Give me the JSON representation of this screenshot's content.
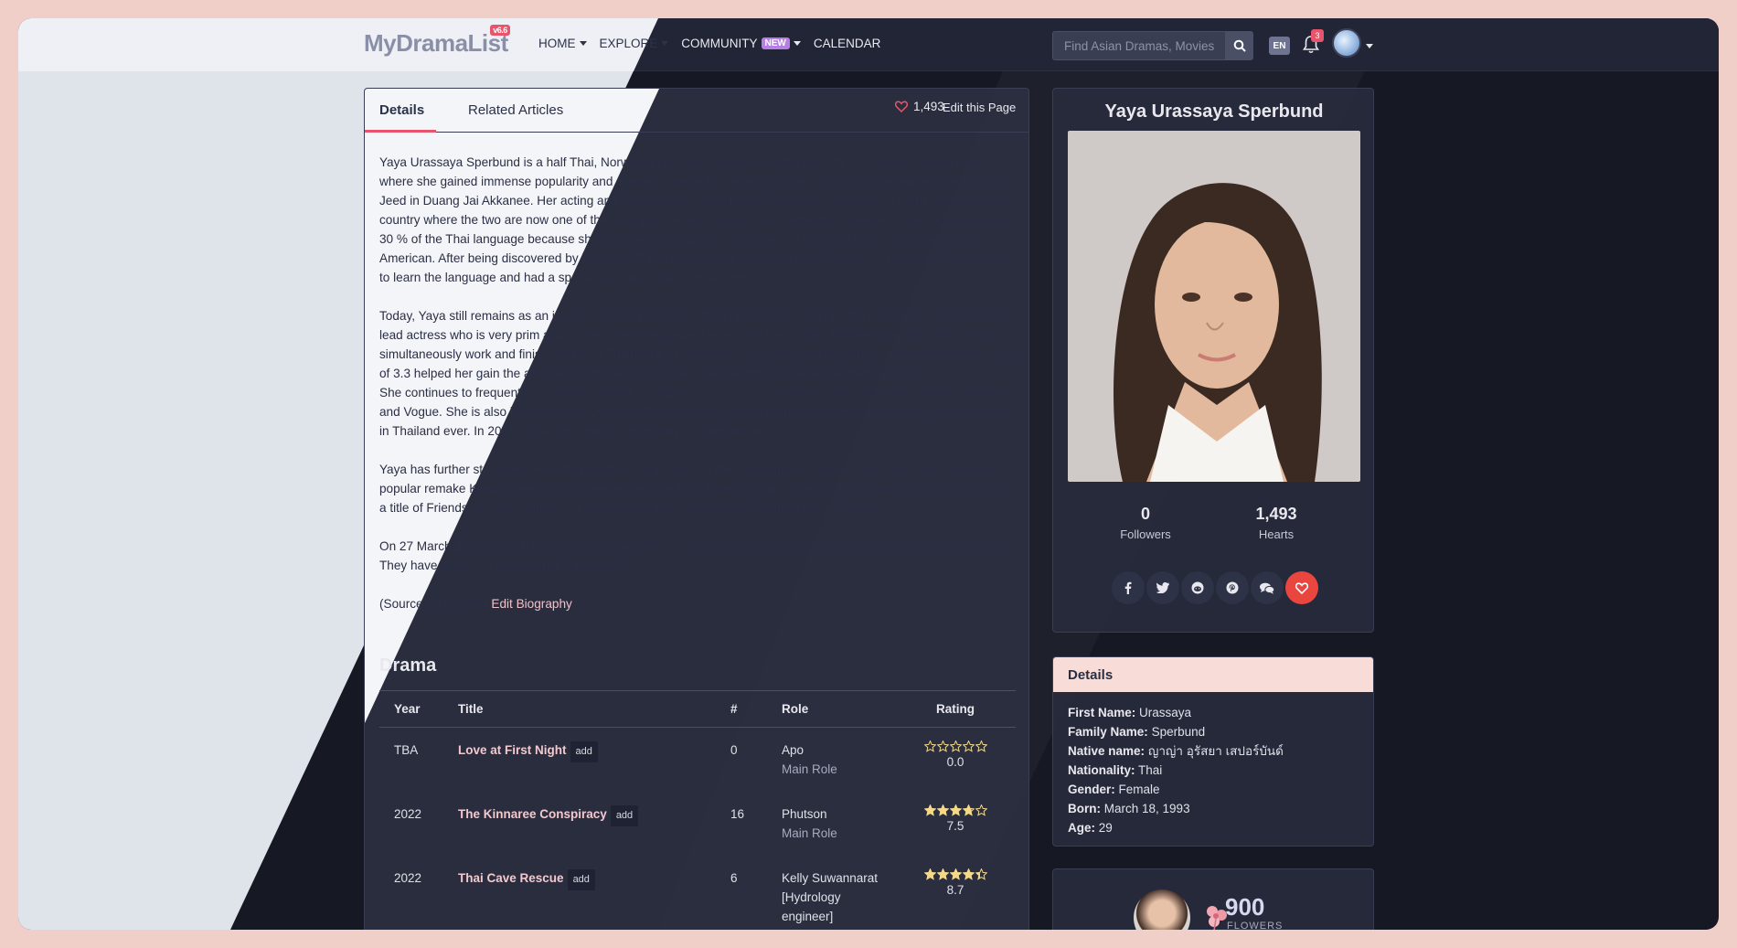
{
  "nav": {
    "logo": "MyDramaList",
    "version": "v6.6",
    "items": [
      {
        "label": "HOME"
      },
      {
        "label": "EXPLORE"
      },
      {
        "label": "COMMUNITY",
        "badge": "NEW"
      },
      {
        "label": "CALENDAR"
      }
    ],
    "search_placeholder": "Find Asian Dramas, Movies",
    "lang": "EN",
    "notifications": "3"
  },
  "tabs": [
    {
      "label": "Details",
      "active": true
    },
    {
      "label": "Related Articles",
      "active": false
    }
  ],
  "page_hearts": "1,493",
  "edit_page": "Edit this Page",
  "bio": [
    "Yaya Urassaya Sperbund is a half Thai, Norwegian actress. She entered the industry in 2008 but it wasn't until 2010 where she gained immense popularity and created a name for herself with her portrayal of the fearless and daring Jeed in Duang Jai Akkanee. Her acting and pairing with co-star Nadech Kugimiya captured so many fans across the country where the two are now one of the most popular koo kwans of this generation. Before, Yaya could only speak 30 % of the Thai language because she attended international school since childhood and most of her friends are American. After being discovered by infamous P'Tue and signing a contract with Channel 3, Yaya motivated herself to learn the language and had a special teacher to tutor her at home.",
    "Today, Yaya still remains as an iconic and loved actress in the Thai industry. She has the reputation of an adorable lead actress who is very prim and proper thus being valued as a good role model. Furthermore, her perseverance to simultaneously work and finish her BA at Thailand's #1 university, Chulalongkorn University, while maintaining a GPA of 3.3 helped her gain the admiration and respect of many people within the entertainment industry.",
    "She continues to frequently model for national magazines such as Cosmopolitan, Elle, Seventeen, Harper's Bazaar and Vogue. She is also known as the 'Queen of Presenters' by having more endorsements than any other actresses in Thailand ever. In 2015, Yaya was seen in more than 30 commercials.",
    "Yaya has further stabilized her acting abilities and position in the entertainment industry with her role of Jeerawat in popular remake Kleun Cheewit, which earned her the Best Actress award. She is the first Thai actress who received a title of Friends of Louis Vuitton and became the first Thai celebrity featured in US Vogue.",
    "On 27 March 2019 Nadech Kugimiya confirmed the rumors via the show SorayuthLive that he and Yaya are dating. They have been in a relationship since 2011."
  ],
  "source": "(Source: Wikipedia)",
  "edit_bio": "Edit Biography",
  "drama_section": "Drama",
  "drama_headers": [
    "Year",
    "Title",
    "#",
    "Role",
    "Rating"
  ],
  "add_label": "add",
  "dramas": [
    {
      "year": "TBA",
      "title": "Love at First Night",
      "episodes": "0",
      "role": [
        "Apo"
      ],
      "role_type": "Main Role",
      "rating": "0.0",
      "stars": 0
    },
    {
      "year": "2022",
      "title": "The Kinnaree Conspiracy",
      "episodes": "16",
      "role": [
        "Phutson"
      ],
      "role_type": "Main Role",
      "rating": "7.5",
      "stars": 3.75
    },
    {
      "year": "2022",
      "title": "Thai Cave Rescue",
      "episodes": "6",
      "role": [
        "Kelly Suwannarat",
        "[Hydrology",
        "engineer]"
      ],
      "role_type": "Main Role",
      "rating": "8.7",
      "stars": 4.35
    }
  ],
  "profile": {
    "name": "Yaya Urassaya Sperbund",
    "followers": "0",
    "followers_label": "Followers",
    "hearts": "1,493",
    "hearts_label": "Hearts"
  },
  "share_icons": [
    "facebook-icon",
    "twitter-icon",
    "reddit-icon",
    "pinterest-icon",
    "comments-icon",
    "heart-icon"
  ],
  "details": {
    "heading": "Details",
    "rows": [
      {
        "k": "First Name:",
        "v": "Urassaya"
      },
      {
        "k": "Family Name:",
        "v": "Sperbund"
      },
      {
        "k": "Native name:",
        "v": "ญาญ่า อุรัสยา เสปอร์บันด์"
      },
      {
        "k": "Nationality:",
        "v": "Thai"
      },
      {
        "k": "Gender:",
        "v": "Female"
      },
      {
        "k": "Born:",
        "v": "March 18, 1993"
      },
      {
        "k": "Age:",
        "v": "29"
      }
    ]
  },
  "flowers": {
    "count": "900",
    "label": "FLOWERS"
  },
  "colors": {
    "accent": "#e8546b",
    "heart": "#e8463f",
    "star": "#f5d98a"
  }
}
